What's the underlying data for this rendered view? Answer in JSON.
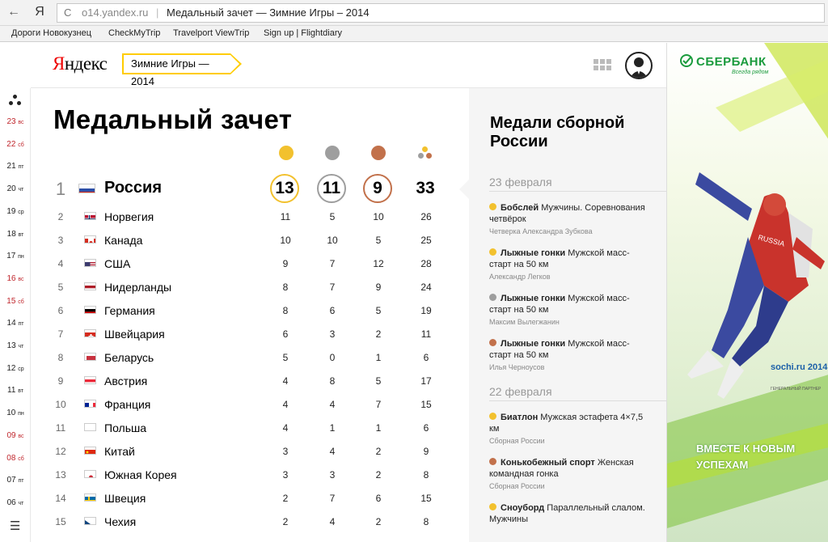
{
  "browser": {
    "back_glyph": "←",
    "yandex_glyph": "Я",
    "reload_glyph": "C",
    "url_host": "o14.yandex.ru",
    "tab_title": "Медальный зачет — Зимние Игры – 2014",
    "bookmarks": [
      "Дороги Новокузнец",
      "CheckMyTrip",
      "Travelport ViewTrip",
      "Sign up | Flightdiary"
    ]
  },
  "header": {
    "logo_first": "Я",
    "logo_rest": "ндекс",
    "games_tag": "Зимние Игры — 2014",
    "apps_icon": "grid-icon",
    "user_icon": "avatar-icon"
  },
  "rail": {
    "days": [
      {
        "d": "23",
        "w": "вс",
        "red": true
      },
      {
        "d": "22",
        "w": "сб",
        "red": true
      },
      {
        "d": "21",
        "w": "пт",
        "red": false
      },
      {
        "d": "20",
        "w": "чт",
        "red": false
      },
      {
        "d": "19",
        "w": "ср",
        "red": false
      },
      {
        "d": "18",
        "w": "вт",
        "red": false
      },
      {
        "d": "17",
        "w": "пн",
        "red": false
      },
      {
        "d": "16",
        "w": "вс",
        "red": true
      },
      {
        "d": "15",
        "w": "сб",
        "red": true
      },
      {
        "d": "14",
        "w": "пт",
        "red": false
      },
      {
        "d": "13",
        "w": "чт",
        "red": false
      },
      {
        "d": "12",
        "w": "ср",
        "red": false
      },
      {
        "d": "11",
        "w": "вт",
        "red": false
      },
      {
        "d": "10",
        "w": "пн",
        "red": false
      },
      {
        "d": "09",
        "w": "вс",
        "red": true
      },
      {
        "d": "08",
        "w": "сб",
        "red": true
      },
      {
        "d": "07",
        "w": "пт",
        "red": false
      },
      {
        "d": "06",
        "w": "чт",
        "red": false
      }
    ],
    "menu_glyph": "☰"
  },
  "table": {
    "title": "Медальный зачет",
    "colors": {
      "gold": "#f2c12e",
      "silver": "#9e9e9e",
      "bronze": "#c2714b"
    },
    "top": {
      "rank": "1",
      "country": "Россия",
      "flag": "ru",
      "gold": "13",
      "silver": "11",
      "bronze": "9",
      "total": "33"
    },
    "rows": [
      {
        "rank": "2",
        "country": "Норвегия",
        "flag": "no",
        "gold": "11",
        "silver": "5",
        "bronze": "10",
        "total": "26"
      },
      {
        "rank": "3",
        "country": "Канада",
        "flag": "ca",
        "gold": "10",
        "silver": "10",
        "bronze": "5",
        "total": "25"
      },
      {
        "rank": "4",
        "country": "США",
        "flag": "us",
        "gold": "9",
        "silver": "7",
        "bronze": "12",
        "total": "28"
      },
      {
        "rank": "5",
        "country": "Нидерланды",
        "flag": "nl",
        "gold": "8",
        "silver": "7",
        "bronze": "9",
        "total": "24"
      },
      {
        "rank": "6",
        "country": "Германия",
        "flag": "de",
        "gold": "8",
        "silver": "6",
        "bronze": "5",
        "total": "19"
      },
      {
        "rank": "7",
        "country": "Швейцария",
        "flag": "ch",
        "gold": "6",
        "silver": "3",
        "bronze": "2",
        "total": "11"
      },
      {
        "rank": "8",
        "country": "Беларусь",
        "flag": "by",
        "gold": "5",
        "silver": "0",
        "bronze": "1",
        "total": "6"
      },
      {
        "rank": "9",
        "country": "Австрия",
        "flag": "at",
        "gold": "4",
        "silver": "8",
        "bronze": "5",
        "total": "17"
      },
      {
        "rank": "10",
        "country": "Франция",
        "flag": "fr",
        "gold": "4",
        "silver": "4",
        "bronze": "7",
        "total": "15"
      },
      {
        "rank": "11",
        "country": "Польша",
        "flag": "pl",
        "gold": "4",
        "silver": "1",
        "bronze": "1",
        "total": "6"
      },
      {
        "rank": "12",
        "country": "Китай",
        "flag": "cn",
        "gold": "3",
        "silver": "4",
        "bronze": "2",
        "total": "9"
      },
      {
        "rank": "13",
        "country": "Южная Корея",
        "flag": "kr",
        "gold": "3",
        "silver": "3",
        "bronze": "2",
        "total": "8"
      },
      {
        "rank": "14",
        "country": "Швеция",
        "flag": "se",
        "gold": "2",
        "silver": "7",
        "bronze": "6",
        "total": "15"
      },
      {
        "rank": "15",
        "country": "Чехия",
        "flag": "cz",
        "gold": "2",
        "silver": "4",
        "bronze": "2",
        "total": "8"
      }
    ]
  },
  "news": {
    "title": "Медали сборной России",
    "groups": [
      {
        "date": "23 февраля",
        "items": [
          {
            "medal": "gold",
            "sport": "Бобслей",
            "event": "Мужчины. Соревнования четвёрок",
            "who": "Четверка Александра Зубкова"
          },
          {
            "medal": "gold",
            "sport": "Лыжные гонки",
            "event": "Мужской масс-старт на 50 км",
            "who": "Александр Легков"
          },
          {
            "medal": "silver",
            "sport": "Лыжные гонки",
            "event": "Мужской масс-старт на 50 км",
            "who": "Максим Вылегжанин"
          },
          {
            "medal": "bronze",
            "sport": "Лыжные гонки",
            "event": "Мужской масс-старт на 50 км",
            "who": "Илья Черноусов"
          }
        ]
      },
      {
        "date": "22 февраля",
        "items": [
          {
            "medal": "gold",
            "sport": "Биатлон",
            "event": "Мужская эстафета 4×7,5 км",
            "who": "Сборная России"
          },
          {
            "medal": "bronze",
            "sport": "Конькобежный спорт",
            "event": "Женская командная гонка",
            "who": "Сборная России"
          },
          {
            "medal": "gold",
            "sport": "Сноуборд",
            "event": "Параллельный слалом. Мужчины",
            "who": ""
          }
        ]
      }
    ]
  },
  "ad": {
    "brand": "СБЕРБАНК",
    "brand_sub": "Всегда рядом",
    "slogan_1": "ВМЕСТЕ К НОВЫМ",
    "slogan_2": "УСПЕХАМ",
    "sochi": "sochi.ru 2014",
    "sochi_sub": "ГЕНЕРАЛЬНЫЙ ПАРТНЕР",
    "suit_text": "RUSSIA"
  }
}
